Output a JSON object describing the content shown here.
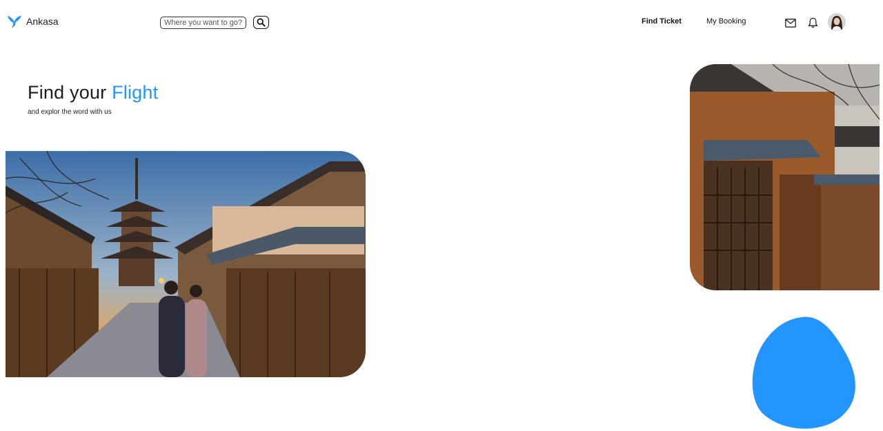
{
  "brand": {
    "name": "Ankasa",
    "logo_icon": "plane-logo-icon",
    "accent_color": "#2395ff"
  },
  "search": {
    "placeholder": "Where you want to go?",
    "button_icon": "search-icon"
  },
  "nav": {
    "find_ticket": "Find Ticket",
    "my_booking": "My Booking"
  },
  "header_icons": {
    "mail": "mail-icon",
    "notifications": "bell-icon",
    "avatar": "user-avatar"
  },
  "hero": {
    "title_prefix": "Find your",
    "title_highlight": "Flight",
    "subtitle": "and explor the word with us"
  },
  "images": {
    "main": "kyoto-street-photo",
    "side": "kyoto-house-photo"
  },
  "decor": {
    "blob_color": "#2395ff"
  }
}
